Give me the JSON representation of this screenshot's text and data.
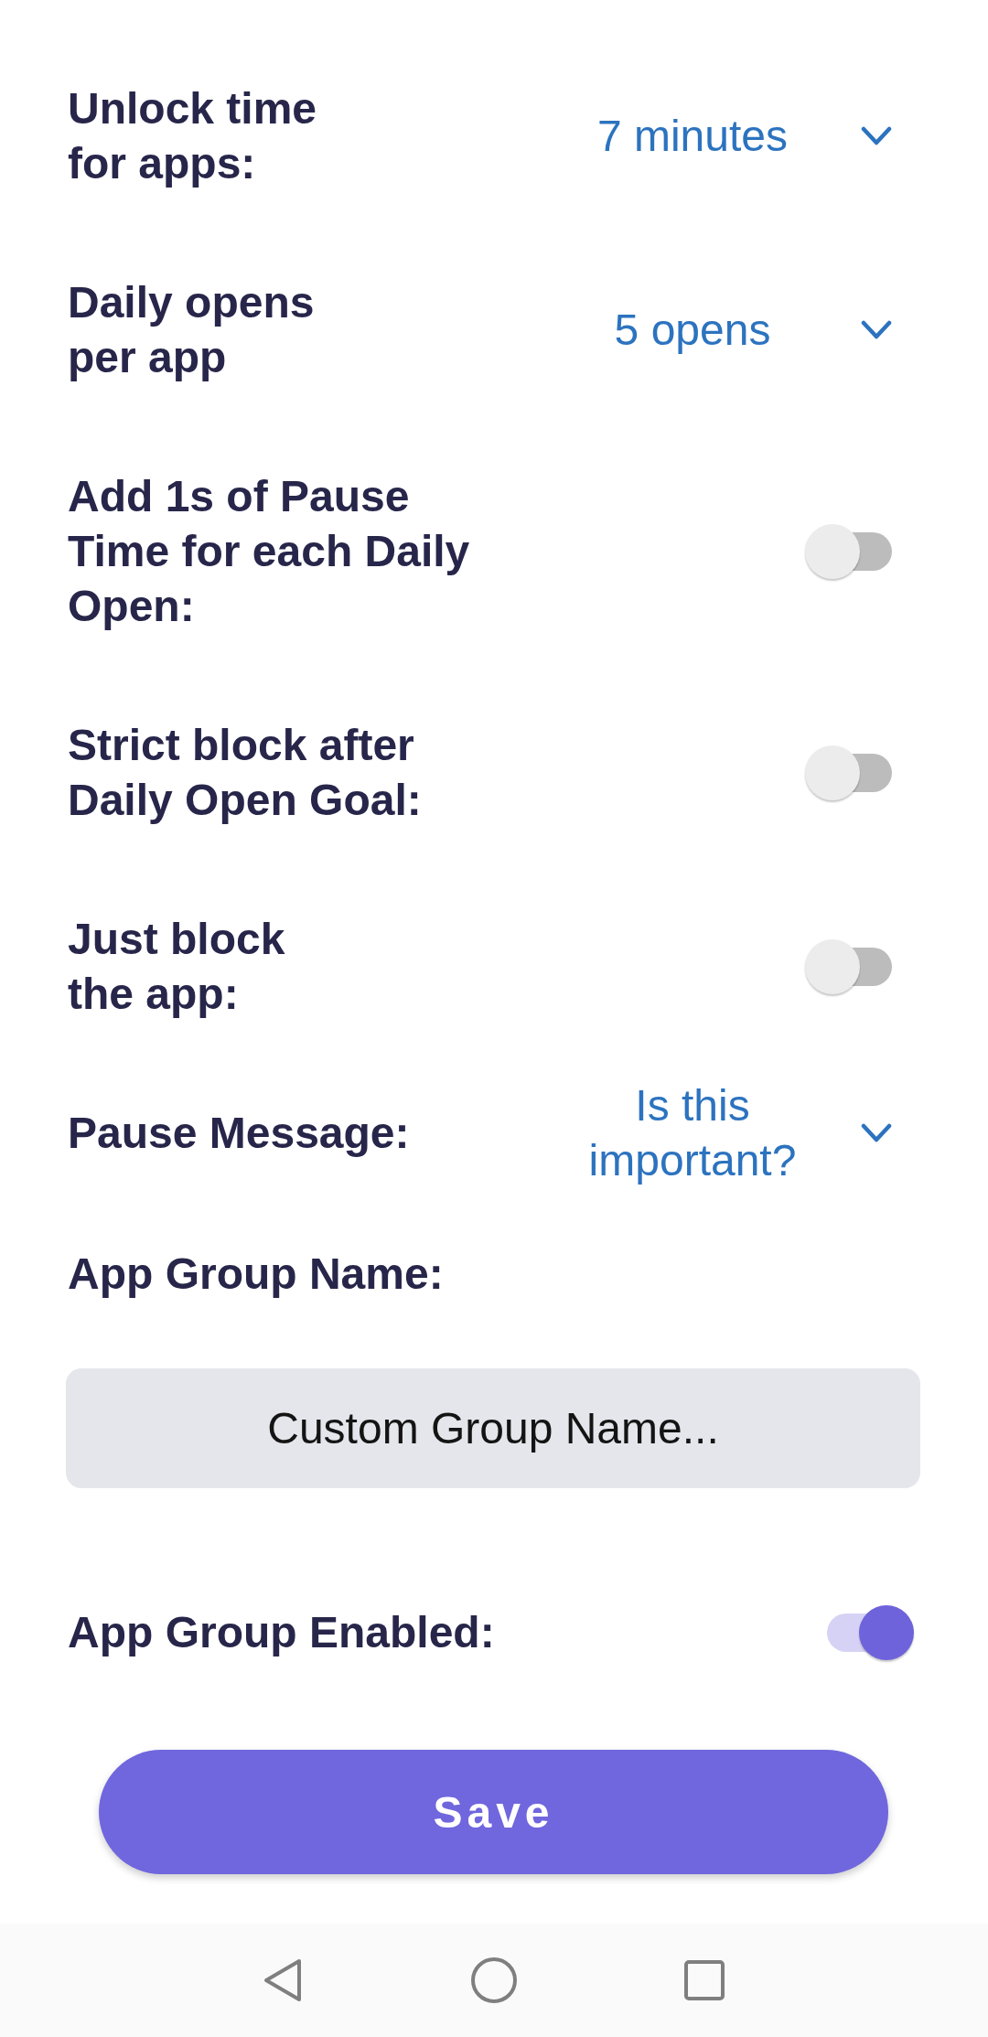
{
  "settings": [
    {
      "kind": "dropdown",
      "label": "Unlock time\nfor apps:",
      "value": "7 minutes"
    },
    {
      "kind": "dropdown",
      "label": "Daily opens\nper app",
      "value": "5 opens"
    },
    {
      "kind": "toggle",
      "label": "Add 1s of Pause\nTime for each Daily\nOpen:",
      "on": false
    },
    {
      "kind": "toggle",
      "label": "Strict block after\nDaily Open Goal:",
      "on": false
    },
    {
      "kind": "toggle",
      "label": "Just block\nthe app:",
      "on": false
    },
    {
      "kind": "dropdown",
      "label": "Pause Message:",
      "value": "Is this important?"
    }
  ],
  "group_name": {
    "label": "App Group Name:",
    "placeholder": "Custom Group Name..."
  },
  "group_enabled": {
    "label": "App Group Enabled:",
    "on": true
  },
  "save_button": "Save"
}
